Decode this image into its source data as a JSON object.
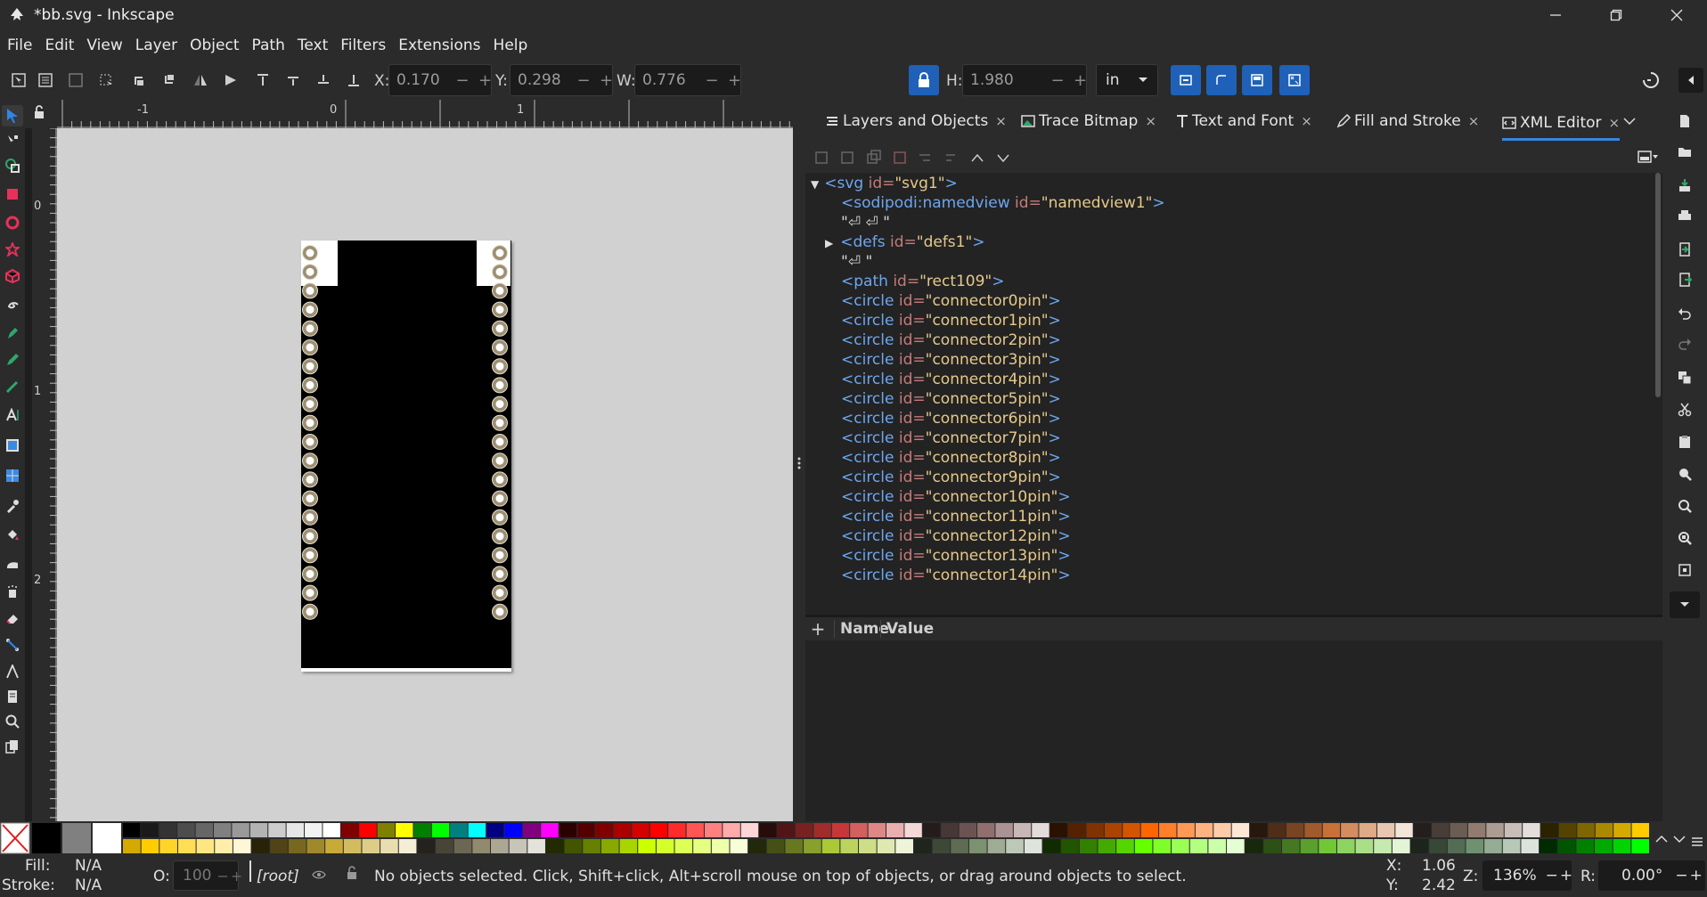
{
  "window": {
    "title": "*bb.svg - Inkscape",
    "controls": [
      "minimize",
      "restore",
      "close"
    ]
  },
  "menubar": [
    "File",
    "Edit",
    "View",
    "Layer",
    "Object",
    "Path",
    "Text",
    "Filters",
    "Extensions",
    "Help"
  ],
  "toolcontrols": {
    "x_label": "X:",
    "x_value": "0.170",
    "y_label": "Y:",
    "y_value": "0.298",
    "w_label": "W:",
    "w_value": "0.776",
    "h_label": "H:",
    "h_value": "1.980",
    "unit": "in",
    "minus": "−",
    "plus": "+"
  },
  "ruler": {
    "top_labels": [
      "-1",
      "0",
      "1"
    ],
    "left_labels": [
      "0",
      "1",
      "2"
    ]
  },
  "dock": {
    "tabs": [
      "Layers and Objects",
      "Trace Bitmap",
      "Text and Font",
      "Fill and Stroke",
      "XML Editor"
    ],
    "close_glyph": "×",
    "active_tab": "XML Editor"
  },
  "xml": {
    "svg_tag": "<svg",
    "svg_attr": "id=",
    "svg_val": "\"svg1\"",
    "svg_close": ">",
    "namedview_tag": "<sodipodi:namedview",
    "namedview_attr": "id=",
    "namedview_val": "\"namedview1\"",
    "namedview_close": ">",
    "text1": "\"⏎  ⏎  \"",
    "defs_tag": "<defs",
    "defs_attr": "id=",
    "defs_val": "\"defs1\"",
    "defs_close": ">",
    "text2": "\"⏎  \"",
    "path_tag": "<path",
    "path_attr": "id=",
    "path_val": "\"rect109\"",
    "path_close": ">",
    "circle_tag": "<circle",
    "circle_attr": "id=",
    "circle_close": ">",
    "circles": [
      "\"connector0pin\"",
      "\"connector1pin\"",
      "\"connector2pin\"",
      "\"connector3pin\"",
      "\"connector4pin\"",
      "\"connector5pin\"",
      "\"connector6pin\"",
      "\"connector7pin\"",
      "\"connector8pin\"",
      "\"connector9pin\"",
      "\"connector10pin\"",
      "\"connector11pin\"",
      "\"connector12pin\"",
      "\"connector13pin\"",
      "\"connector14pin\""
    ]
  },
  "attributes": {
    "add": "+",
    "name_header": "Name",
    "value_header": "Value"
  },
  "status": {
    "fill_label": "Fill:",
    "fill_value": "N/A",
    "stroke_label": "Stroke:",
    "stroke_value": "N/A",
    "opacity_label": "O:",
    "opacity_value": "100",
    "layer": "[root]",
    "message": "No objects selected. Click, Shift+click, Alt+scroll mouse on top of objects, or drag around objects to select.",
    "cursor_x_label": "X:",
    "cursor_x": "1.06",
    "cursor_y_label": "Y:",
    "cursor_y": "2.42",
    "zoom_label": "Z:",
    "zoom": "136%",
    "rotation_label": "R:",
    "rotation": "0.00°"
  },
  "palette": {
    "top_row": [
      "#000000",
      "#1a1a1a",
      "#333333",
      "#4d4d4d",
      "#666666",
      "#808080",
      "#999999",
      "#b3b3b3",
      "#cccccc",
      "#e6e6e6",
      "#f2f2f2",
      "#ffffff",
      "#800000",
      "#ff0000",
      "#808000",
      "#ffff00",
      "#008000",
      "#00ff00",
      "#008080",
      "#00ffff",
      "#000080",
      "#0000ff",
      "#800080",
      "#ff00ff",
      "#2b0000",
      "#550000",
      "#800000",
      "#aa0000",
      "#d40000",
      "#ff0000",
      "#ff2a2a",
      "#ff5555",
      "#ff8080",
      "#ffaaaa",
      "#ffd5d5",
      "#280b0b",
      "#501616",
      "#782121",
      "#a02c2c",
      "#c83737",
      "#d35f5f",
      "#de8787",
      "#e9afaf",
      "#f4d7d7",
      "#241c1c",
      "#483737",
      "#6c5353",
      "#916f6f",
      "#ac9393",
      "#c8b7b7",
      "#e3dbdb",
      "#2b1100",
      "#552200",
      "#803300",
      "#aa4400",
      "#d45500",
      "#ff6600",
      "#ff7f2a",
      "#ff9955",
      "#ffb380",
      "#ffccaa",
      "#ffe6d5",
      "#28170b",
      "#502d16",
      "#784421",
      "#a05a2c",
      "#c87137",
      "#d38d5f",
      "#deaa87",
      "#e9c6af",
      "#f4e3d7",
      "#241f1c",
      "#483e37",
      "#6c5d53",
      "#917c6f",
      "#ac9d93",
      "#c8beb7",
      "#e3dedb",
      "#2b2200",
      "#554400",
      "#806600",
      "#aa8800",
      "#d4aa00",
      "#ffcc00"
    ],
    "bottom_row": [
      "#d4aa00",
      "#ffcc00",
      "#ffd42a",
      "#ffdd55",
      "#ffe680",
      "#ffeeaa",
      "#fff6d5",
      "#28220b",
      "#504416",
      "#786721",
      "#a0892c",
      "#c8ab37",
      "#d3bc5f",
      "#decd87",
      "#e9ddaf",
      "#f4eed7",
      "#24221c",
      "#484537",
      "#6c6753",
      "#918a6f",
      "#aca793",
      "#c8c4b7",
      "#e3e2db",
      "#222b00",
      "#445500",
      "#668000",
      "#88aa00",
      "#aad400",
      "#ccff00",
      "#d4ff2a",
      "#ddff55",
      "#e5ff80",
      "#eeffaa",
      "#f6ffd5",
      "#22280b",
      "#445016",
      "#677821",
      "#89a02c",
      "#abc837",
      "#bcd35f",
      "#cdde87",
      "#dde9af",
      "#eef4d7",
      "#1f241c",
      "#3e4837",
      "#5d6c53",
      "#7c916f",
      "#9dac93",
      "#bec8b7",
      "#dee3db",
      "#112b00",
      "#225500",
      "#338000",
      "#44aa00",
      "#55d400",
      "#66ff00",
      "#7fff2a",
      "#99ff55",
      "#b3ff80",
      "#ccffaa",
      "#e5ffd5",
      "#17280b",
      "#2d5016",
      "#447821",
      "#5aa02c",
      "#71c837",
      "#8dd35f",
      "#aade87",
      "#c6e9af",
      "#e3f4d7",
      "#1c241c",
      "#374837",
      "#536c53",
      "#6f916f",
      "#93ac93",
      "#b7c8b7",
      "#dbe3db",
      "#002b00",
      "#005500",
      "#008000",
      "#00aa00",
      "#00d400",
      "#00ff00"
    ],
    "fixed": [
      "#000000",
      "#808080",
      "#ffffff"
    ]
  },
  "accent": "#1f61b8"
}
